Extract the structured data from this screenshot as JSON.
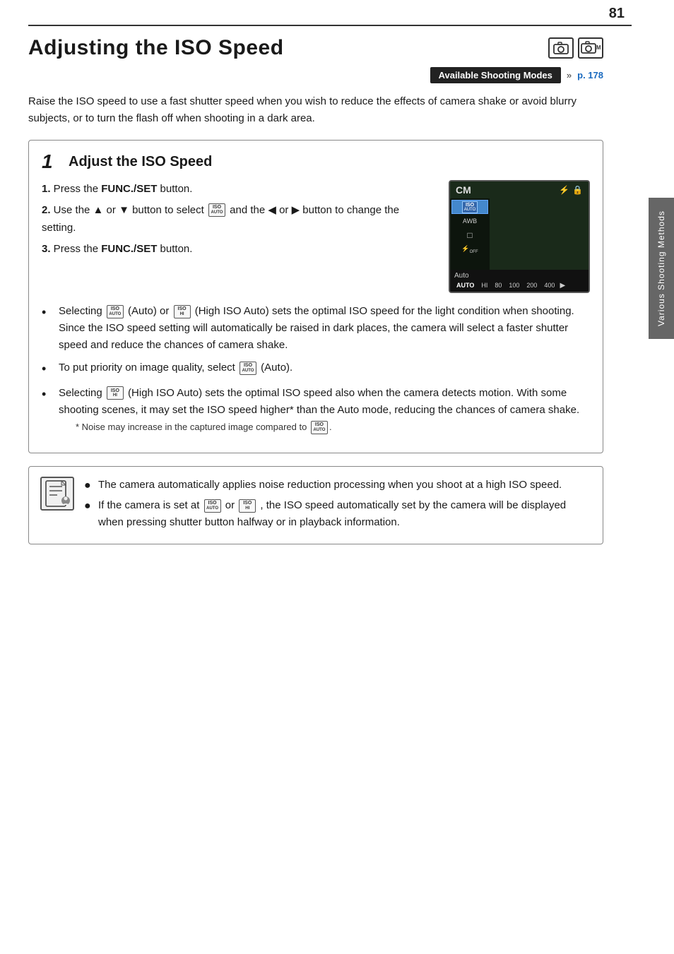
{
  "page": {
    "number": "81",
    "sidebar_label": "Various Shooting Methods"
  },
  "header": {
    "title": "Adjusting the ISO Speed",
    "camera_icons": [
      "▣",
      "◫"
    ],
    "available_modes_label": "Available Shooting Modes",
    "page_ref": "p. 178"
  },
  "intro": {
    "text": "Raise the ISO speed to use a fast shutter speed when you wish to reduce the effects of camera shake or avoid blurry subjects, or to turn the flash off when shooting in a dark area."
  },
  "step": {
    "number": "1",
    "title": "Adjust the ISO Speed",
    "instructions": [
      {
        "num": "1.",
        "text_before": "Press the ",
        "bold": "FUNC./SET",
        "text_after": " button."
      },
      {
        "num": "2.",
        "text_before": "Use the ▲ or ▼ button to select ",
        "iso_icon": "ISO AUTO",
        "text_middle": " and the ◀ or ▶ button to change the setting.",
        "bold": ""
      },
      {
        "num": "3.",
        "text_before": "Press the ",
        "bold": "FUNC./SET",
        "text_after": " button."
      }
    ],
    "bullets": [
      {
        "text": "Selecting (Auto) or (High ISO Auto) sets the optimal ISO speed for the light condition when shooting. Since the ISO speed setting will automatically be raised in dark places, the camera will select a faster shutter speed and reduce the chances of camera shake."
      },
      {
        "text": "To put priority on image quality, select (Auto)."
      },
      {
        "text": "Selecting (High ISO Auto) sets the optimal ISO speed also when the camera detects motion. With some shooting scenes, it may set the ISO speed higher* than the Auto mode, reducing the chances of camera shake.",
        "footnote": "* Noise may increase in the captured image compared to ."
      }
    ]
  },
  "notes": [
    {
      "text": "The camera automatically applies noise reduction processing when you shoot at a high ISO speed."
    },
    {
      "text": "If the camera is set at  or , the ISO speed automatically set by the camera will be displayed when pressing shutter button halfway or in playback information."
    }
  ],
  "camera_screen": {
    "mode": "CM",
    "menu_items": [
      "ISO AUTO",
      "AWB",
      "□",
      "⚡OFF"
    ],
    "iso_values": [
      "AUTO",
      "HI",
      "80",
      "100",
      "200",
      "400"
    ],
    "auto_label": "Auto"
  }
}
